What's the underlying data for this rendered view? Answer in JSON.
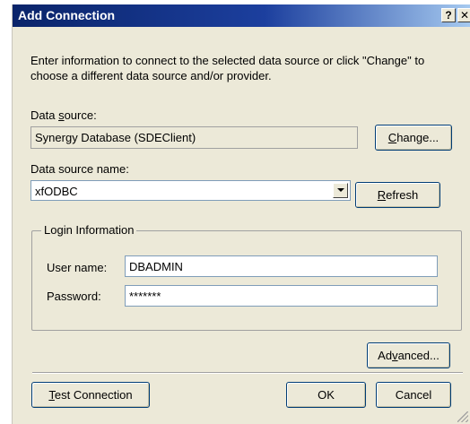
{
  "window": {
    "title": "Add Connection",
    "help_label": "?",
    "close_label": "✕"
  },
  "intro_text": "Enter information to connect to the selected data source or click \"Change\" to choose a different data source and/or provider.",
  "data_source": {
    "label_pre": "Data ",
    "label_accel": "s",
    "label_post": "ource:",
    "value": "Synergy Database (SDEClient)",
    "change_pre": "",
    "change_accel": "C",
    "change_post": "hange..."
  },
  "data_source_name": {
    "label": "Data source name:",
    "value": "xfODBC",
    "refresh_pre": "",
    "refresh_accel": "R",
    "refresh_post": "efresh"
  },
  "login": {
    "group_label": "Login Information",
    "user_label": "User name:",
    "user_value": "DBADMIN",
    "password_label": "Password:",
    "password_value": "*******"
  },
  "buttons": {
    "advanced_pre": "Ad",
    "advanced_accel": "v",
    "advanced_post": "anced...",
    "test_pre": "",
    "test_accel": "T",
    "test_post": "est Connection",
    "ok": "OK",
    "cancel": "Cancel"
  }
}
